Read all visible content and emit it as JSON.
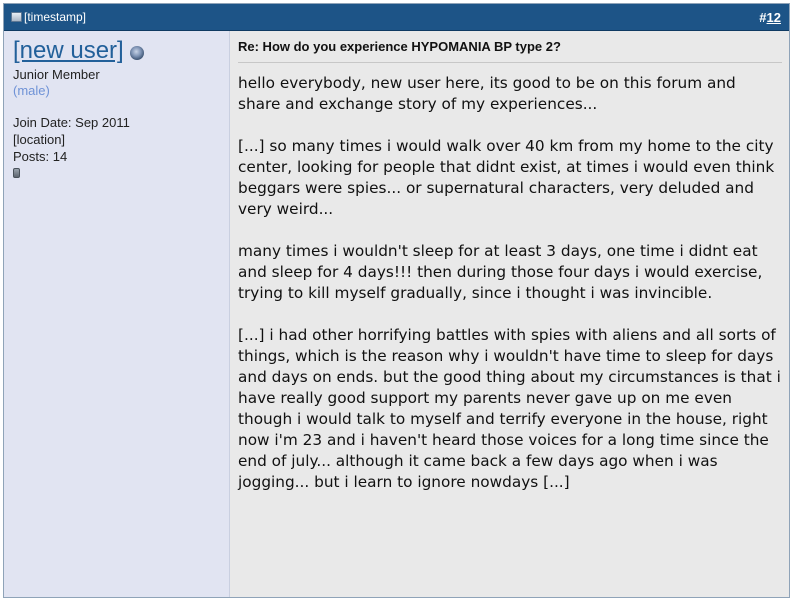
{
  "header": {
    "timestamp": "[timestamp]",
    "post_number_prefix": "#",
    "post_number": "12"
  },
  "user": {
    "name": "[new user]",
    "title": "Junior Member",
    "gender": "(male)",
    "join_date": "Join Date: Sep 2011",
    "location": "[location]",
    "posts": "Posts: 14",
    "online_icon": "offline-status-icon",
    "reputation_icon": "reputation-icon"
  },
  "post": {
    "title": "Re: How do you experience HYPOMANIA BP type 2?",
    "paragraphs": [
      "hello everybody, new user here, its good to be on this forum and share and exchange story of my experiences...",
      "[...] so many times i would walk over 40 km from my home to the city center, looking for people that didnt exist, at times i would even think beggars were spies... or supernatural characters, very deluded and very weird...",
      "many times i wouldn't sleep for at least 3 days, one time i didnt eat and sleep for 4 days!!! then during those four days i would exercise, trying to kill myself gradually, since i thought i was invincible.",
      "[...] i had other horrifying battles with spies with aliens and all sorts of things, which is the reason why i wouldn't have time to sleep for days and days on ends. but the good thing about my circumstances is that i have really good support my parents never gave up on me even though i would talk to myself and terrify everyone in the house, right now i'm 23 and i haven't heard those voices for a long time since the end of july... although it came back a few days ago when i was jogging... but i learn to ignore nowdays [...]"
    ]
  },
  "colors": {
    "header_bg": "#1d5487",
    "userinfo_bg": "#e1e4f2",
    "message_bg": "#e9e9e9",
    "username_link": "#22609a",
    "gender_text": "#6f92d6"
  }
}
